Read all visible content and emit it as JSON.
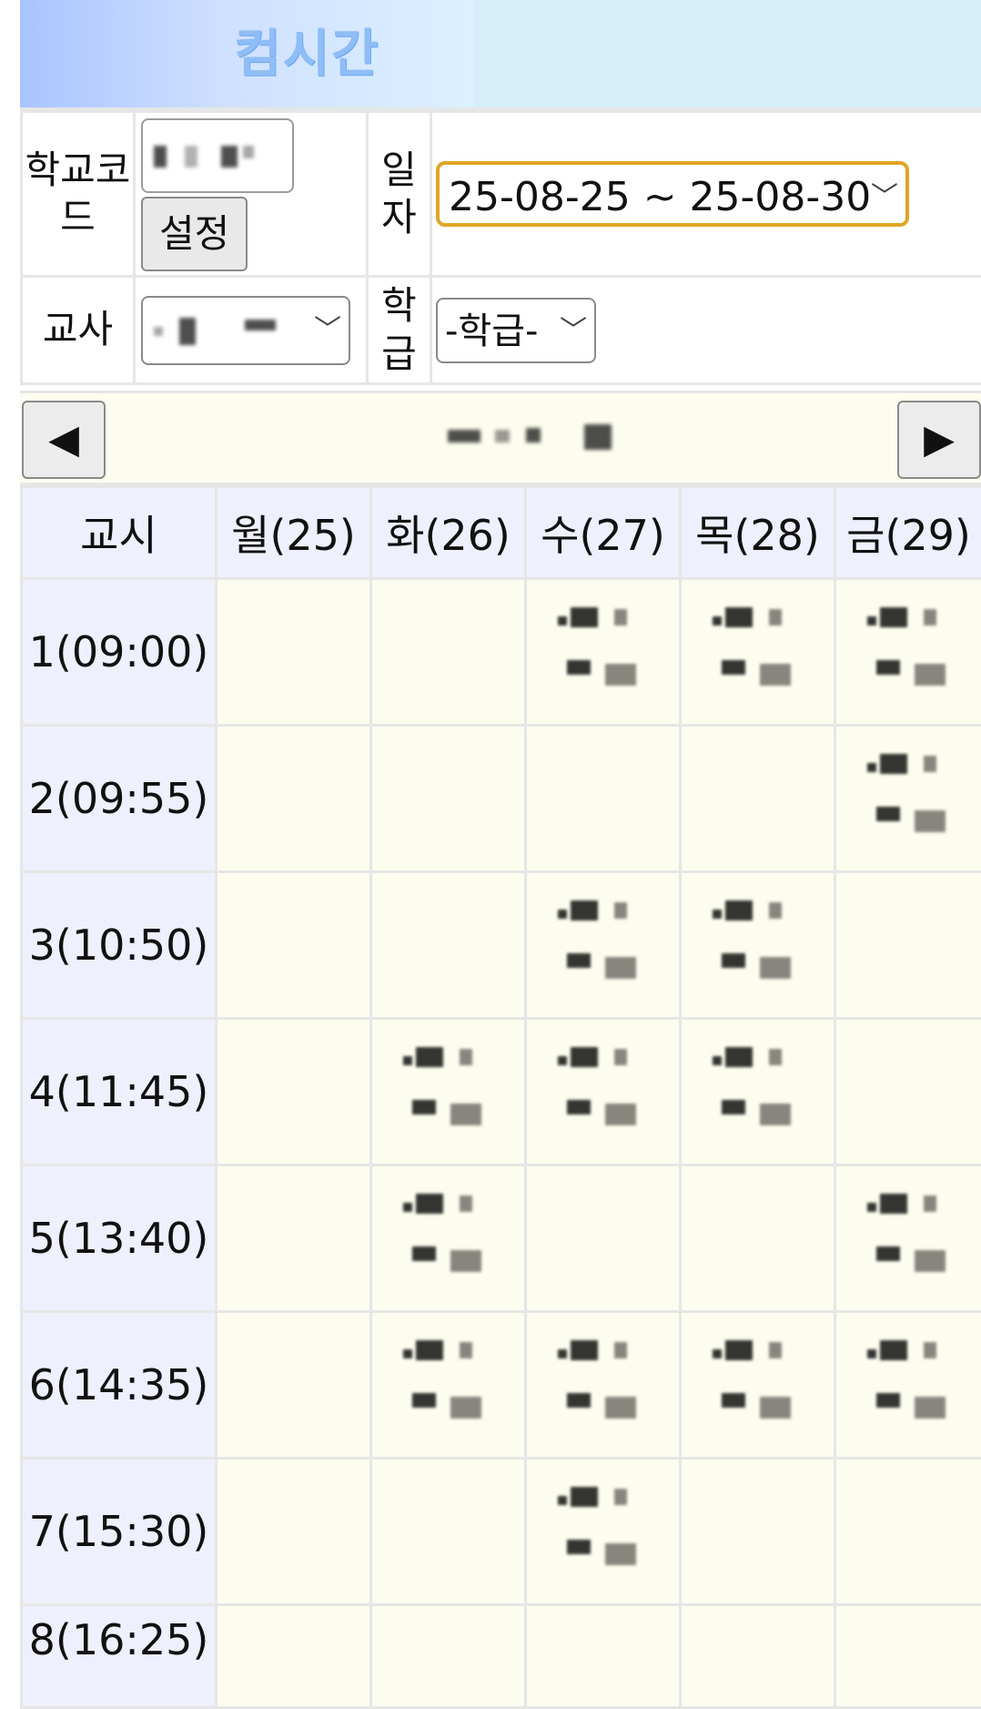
{
  "header": {
    "title": "컴시간"
  },
  "settings": {
    "school_code_label": "학교코드",
    "set_button": "설정",
    "date_label": "일자",
    "date_value": "25-08-25 ~ 25-08-30",
    "teacher_label": "교사",
    "class_label": "학급",
    "class_value": "-학급-"
  },
  "nav": {
    "prev": "◀",
    "next": "▶"
  },
  "timetable": {
    "header": [
      "교시",
      "월(25)",
      "화(26)",
      "수(27)",
      "목(28)",
      "금(29)"
    ],
    "periods": [
      "1(09:00)",
      "2(09:55)",
      "3(10:50)",
      "4(11:45)",
      "5(13:40)",
      "6(14:35)",
      "7(15:30)",
      "8(16:25)"
    ]
  },
  "colors": {
    "accent_border": "#e0a526",
    "period_bg": "#eef0fd",
    "cell_bg": "#fdfdef",
    "banner_bg": "#d6eefa"
  }
}
